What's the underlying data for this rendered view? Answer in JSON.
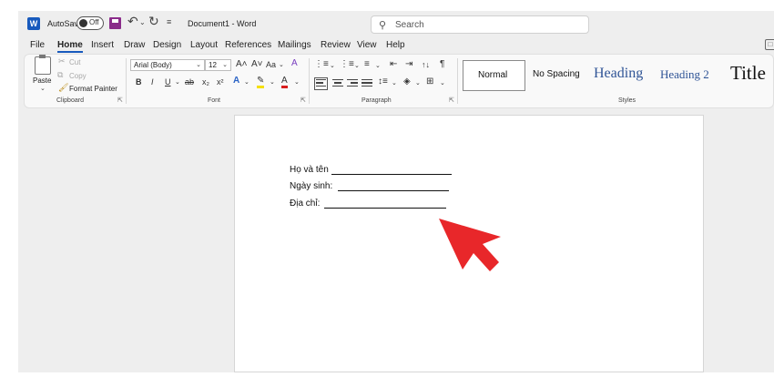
{
  "titlebar": {
    "autosave_label": "AutoSave",
    "autosave_state": "Off",
    "doc_title": "Document1  -  Word",
    "search_placeholder": "Search"
  },
  "tabs": [
    {
      "label": "File",
      "active": false
    },
    {
      "label": "Home",
      "active": true
    },
    {
      "label": "Insert",
      "active": false
    },
    {
      "label": "Draw",
      "active": false
    },
    {
      "label": "Design",
      "active": false
    },
    {
      "label": "Layout",
      "active": false
    },
    {
      "label": "References",
      "active": false
    },
    {
      "label": "Mailings",
      "active": false
    },
    {
      "label": "Review",
      "active": false
    },
    {
      "label": "View",
      "active": false
    },
    {
      "label": "Help",
      "active": false
    }
  ],
  "clipboard": {
    "paste_label": "Paste",
    "cut_label": "Cut",
    "copy_label": "Copy",
    "format_painter_label": "Format Painter",
    "group_label": "Clipboard"
  },
  "font": {
    "font_name": "Arial (Body)",
    "font_size": "12",
    "grow": "A˄",
    "shrink": "A˅",
    "change_case": "Aa",
    "clear_format": "A",
    "bold": "B",
    "italic": "I",
    "underline": "U",
    "strikethrough": "ab",
    "subscript": "x₂",
    "superscript": "x²",
    "text_effects": "A",
    "highlight": "✎",
    "font_color": "A",
    "group_label": "Font"
  },
  "paragraph": {
    "sort": "↑↓",
    "pilcrow": "¶",
    "group_label": "Paragraph"
  },
  "styles": {
    "items": [
      "Normal",
      "No Spacing",
      "Heading",
      "Heading 2",
      "Title"
    ],
    "group_label": "Styles"
  },
  "document": {
    "lines": [
      "Họ và tên",
      "Ngày sinh: ",
      "Địa chỉ: "
    ]
  },
  "colors": {
    "accent": "#185abd",
    "heading": "#2f5496",
    "arrow": "#e8272a",
    "chrome": "#eeeeee"
  }
}
